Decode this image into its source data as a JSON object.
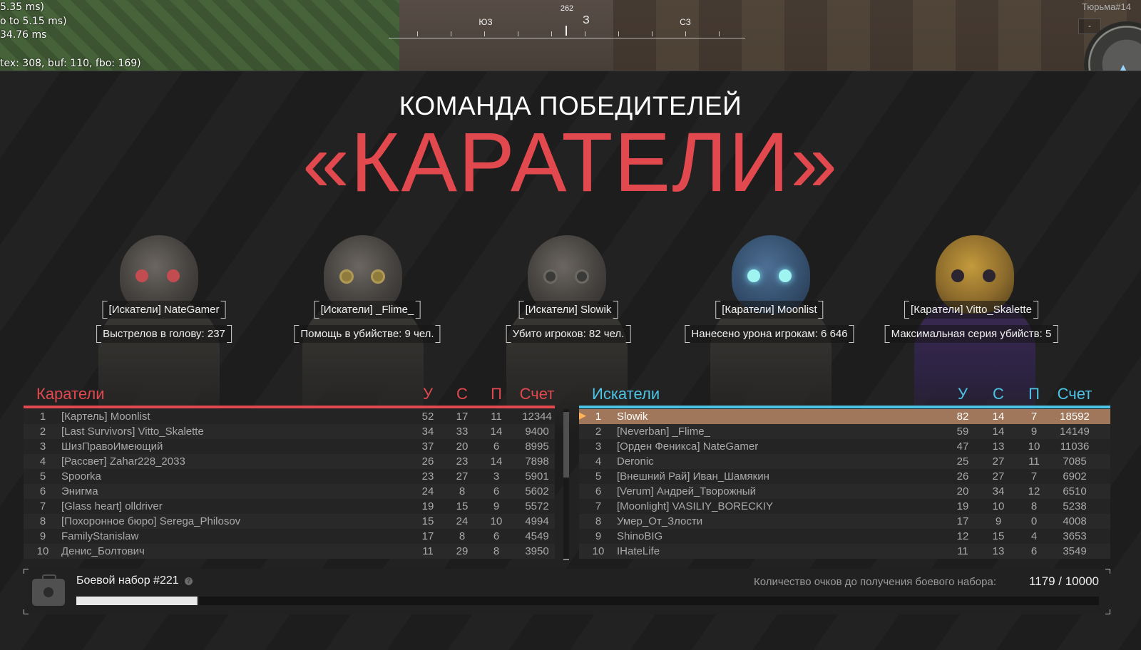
{
  "debug": {
    "lines": [
      "5.35 ms)",
      "o to 5.15 ms)",
      "34.76 ms",
      "tex: 308, buf: 110, fbo: 169)"
    ]
  },
  "compass": {
    "heading": "262",
    "labels": [
      "ЮЗ",
      "З",
      "СЗ"
    ]
  },
  "minimap": {
    "label": "Тюрьма#14",
    "button_label": "-"
  },
  "header": {
    "subtitle": "КОМАНДА ПОБЕДИТЕЛЕЙ",
    "winner": "«КАРАТЕЛИ»"
  },
  "highlights": [
    {
      "player": "[Искатели] NateGamer",
      "stat": "Выстрелов в голову: 237",
      "color": "red"
    },
    {
      "player": "[Искатели] _Flime_",
      "stat": "Помощь в убийстве: 9 чел.",
      "color": "gold"
    },
    {
      "player": "[Искатели] Slowik",
      "stat": "Убито игроков: 82 чел.",
      "color": "gray"
    },
    {
      "player": "[Каратели] Moonlist",
      "stat": "Нанесено урона игрокам: 6 646",
      "color": "blue"
    },
    {
      "player": "[Каратели] Vitto_Skalette",
      "stat": "Максимальная серия убийств: 5",
      "color": "purple"
    }
  ],
  "teams": {
    "left": {
      "name": "Каратели",
      "accent": "#e2494e",
      "columns": [
        "У",
        "С",
        "П",
        "Счет"
      ],
      "rows": [
        {
          "rank": "1",
          "name": "[Картель] Moonlist",
          "k": "52",
          "d": "17",
          "a": "11",
          "score": "12344"
        },
        {
          "rank": "2",
          "name": "[Last Survivors] Vitto_Skalette",
          "k": "34",
          "d": "33",
          "a": "14",
          "score": "9400"
        },
        {
          "rank": "3",
          "name": "ШизПравоИмеющий",
          "k": "37",
          "d": "20",
          "a": "6",
          "score": "8995"
        },
        {
          "rank": "4",
          "name": "[Рассвет] Zahar228_2033",
          "k": "26",
          "d": "23",
          "a": "14",
          "score": "7898"
        },
        {
          "rank": "5",
          "name": "Spoorka",
          "k": "23",
          "d": "27",
          "a": "3",
          "score": "5901"
        },
        {
          "rank": "6",
          "name": "Энигма",
          "k": "24",
          "d": "8",
          "a": "6",
          "score": "5602"
        },
        {
          "rank": "7",
          "name": "[Glass heart] olldriver",
          "k": "19",
          "d": "15",
          "a": "9",
          "score": "5572"
        },
        {
          "rank": "8",
          "name": "[Похоронное бюро] Serega_Philosov",
          "k": "15",
          "d": "24",
          "a": "10",
          "score": "4994"
        },
        {
          "rank": "9",
          "name": "FamilyStanislaw",
          "k": "17",
          "d": "8",
          "a": "6",
          "score": "4549"
        },
        {
          "rank": "10",
          "name": "Денис_Болтович",
          "k": "11",
          "d": "29",
          "a": "8",
          "score": "3950"
        }
      ]
    },
    "right": {
      "name": "Искатели",
      "accent": "#4cc4e6",
      "columns": [
        "У",
        "С",
        "П",
        "Счет"
      ],
      "rows": [
        {
          "rank": "1",
          "name": "Slowik",
          "k": "82",
          "d": "14",
          "a": "7",
          "score": "18592"
        },
        {
          "rank": "2",
          "name": "[Neverban] _Flime_",
          "k": "59",
          "d": "14",
          "a": "9",
          "score": "14149"
        },
        {
          "rank": "3",
          "name": "[Орден Феникса] NateGamer",
          "k": "47",
          "d": "13",
          "a": "10",
          "score": "11036"
        },
        {
          "rank": "4",
          "name": "Deronic",
          "k": "25",
          "d": "27",
          "a": "11",
          "score": "7085"
        },
        {
          "rank": "5",
          "name": "[Внешний Рай] Иван_Шамякин",
          "k": "26",
          "d": "27",
          "a": "7",
          "score": "6902"
        },
        {
          "rank": "6",
          "name": "[Verum] Андрей_Творожный",
          "k": "20",
          "d": "34",
          "a": "12",
          "score": "6510"
        },
        {
          "rank": "7",
          "name": "[Moonlight] VASILIY_BORECKIY",
          "k": "19",
          "d": "10",
          "a": "8",
          "score": "5238"
        },
        {
          "rank": "8",
          "name": "Умер_От_Злости",
          "k": "17",
          "d": "9",
          "a": "0",
          "score": "4008"
        },
        {
          "rank": "9",
          "name": "ShinoBIG",
          "k": "12",
          "d": "15",
          "a": "4",
          "score": "3653"
        },
        {
          "rank": "10",
          "name": "IHateLife",
          "k": "11",
          "d": "13",
          "a": "6",
          "score": "3549"
        }
      ]
    }
  },
  "kit": {
    "title": "Боевой набор #221",
    "help_icon": "?",
    "progress_label": "Количество очков до получения боевого набора:",
    "progress_value": "1179 / 10000",
    "progress_fraction": 0.1179
  }
}
